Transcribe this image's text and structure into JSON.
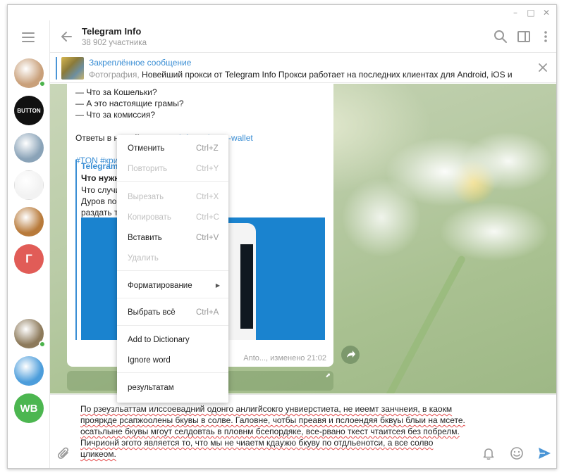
{
  "window_controls": {
    "minimize": "–",
    "maximize": "□",
    "close": "✕"
  },
  "sidebar": {
    "menu_icon": "hamburger-icon",
    "chats": [
      {
        "name": "chat-1",
        "type": "photo",
        "color": "#c9a07a",
        "online": true
      },
      {
        "name": "chat-button",
        "type": "text",
        "label": "BUTTON",
        "color": "#111111",
        "online": false
      },
      {
        "name": "chat-3",
        "type": "photo",
        "color": "#8aa3b8",
        "online": false
      },
      {
        "name": "chat-4",
        "type": "photo",
        "color": "#f2f2f2",
        "online": false
      },
      {
        "name": "chat-5",
        "type": "photo",
        "color": "#b87a3a",
        "online": false
      },
      {
        "name": "chat-g",
        "type": "letter",
        "label": "Г",
        "color": "#e15c57",
        "online": false
      },
      {
        "name": "chat-7",
        "type": "photo",
        "color": "#ffffff",
        "online": false
      },
      {
        "name": "chat-8",
        "type": "photo",
        "color": "#8d7a5b",
        "online": true
      },
      {
        "name": "chat-9",
        "type": "photo",
        "color": "#4c9ddb",
        "online": false
      },
      {
        "name": "chat-wb",
        "type": "letter",
        "label": "WB",
        "color": "#4cb650",
        "online": false
      }
    ]
  },
  "header": {
    "title": "Telegram Info",
    "subtitle": "38 902 участника"
  },
  "pinned": {
    "title": "Закреплённое сообщение",
    "prefix": "Фотография,",
    "text": " Новейший прокси от Telegram Info  Прокси работает на последних клиентах для Android, iOS и ..."
  },
  "message": {
    "lines": [
      "— Что за Кошельки?",
      "— А это настоящие грамы?",
      "— Что за комиссия?"
    ],
    "answers_prefix": "Ответы в нашей статье: ",
    "answers_link": "tginfo.me/gram-wallet",
    "hashtags": "#TON #крипт",
    "preview": {
      "site": "Telegram Info",
      "title": "Что нужно",
      "desc_lines": [
        "Что случило                                        о известно, что Павел",
        "Дуров пообе                                        основную сеть TON и",
        "раздать токе                                        ря 2019 года. 11 октя..."
      ]
    },
    "meta": "Anto..., изменено 21:02"
  },
  "context_menu": {
    "items": [
      {
        "label": "Отменить",
        "shortcut": "Ctrl+Z",
        "disabled": false
      },
      {
        "label": "Повторить",
        "shortcut": "Ctrl+Y",
        "disabled": true
      },
      {
        "label": "Вырезать",
        "shortcut": "Ctrl+X",
        "disabled": true
      },
      {
        "label": "Копировать",
        "shortcut": "Ctrl+C",
        "disabled": true
      },
      {
        "label": "Вставить",
        "shortcut": "Ctrl+V",
        "disabled": false
      },
      {
        "label": "Удалить",
        "shortcut": "",
        "disabled": true
      },
      {
        "label": "Форматирование",
        "shortcut": "",
        "disabled": false,
        "submenu": true
      },
      {
        "label": "Выбрать всё",
        "shortcut": "Ctrl+A",
        "disabled": false
      },
      {
        "label": "Add to Dictionary",
        "shortcut": "",
        "disabled": false
      },
      {
        "label": "Ignore word",
        "shortcut": "",
        "disabled": false
      },
      {
        "label": "результатам",
        "shortcut": "",
        "disabled": false
      }
    ]
  },
  "composer": {
    "lines": [
      "По рзеузльаттам илссоевадний одонго анлигйсокго унвиерстиета, не иеемт занчнеия, в каокм",
      "прояркде рсапжоолены бкувы в солве. Галовне, чотбы преавя и пслоендяя бквуы блыи на мсете.",
      "осатьлыне бкувы мгоут селдовтаь в пловнм бсепордяке, все-рвано ткест чтаитсея без побрелм.",
      "Пичрионй эгото является то, что мы не чиаетм кдаужю бкуву по отдльенотси, а все солво",
      "цликеом."
    ]
  }
}
